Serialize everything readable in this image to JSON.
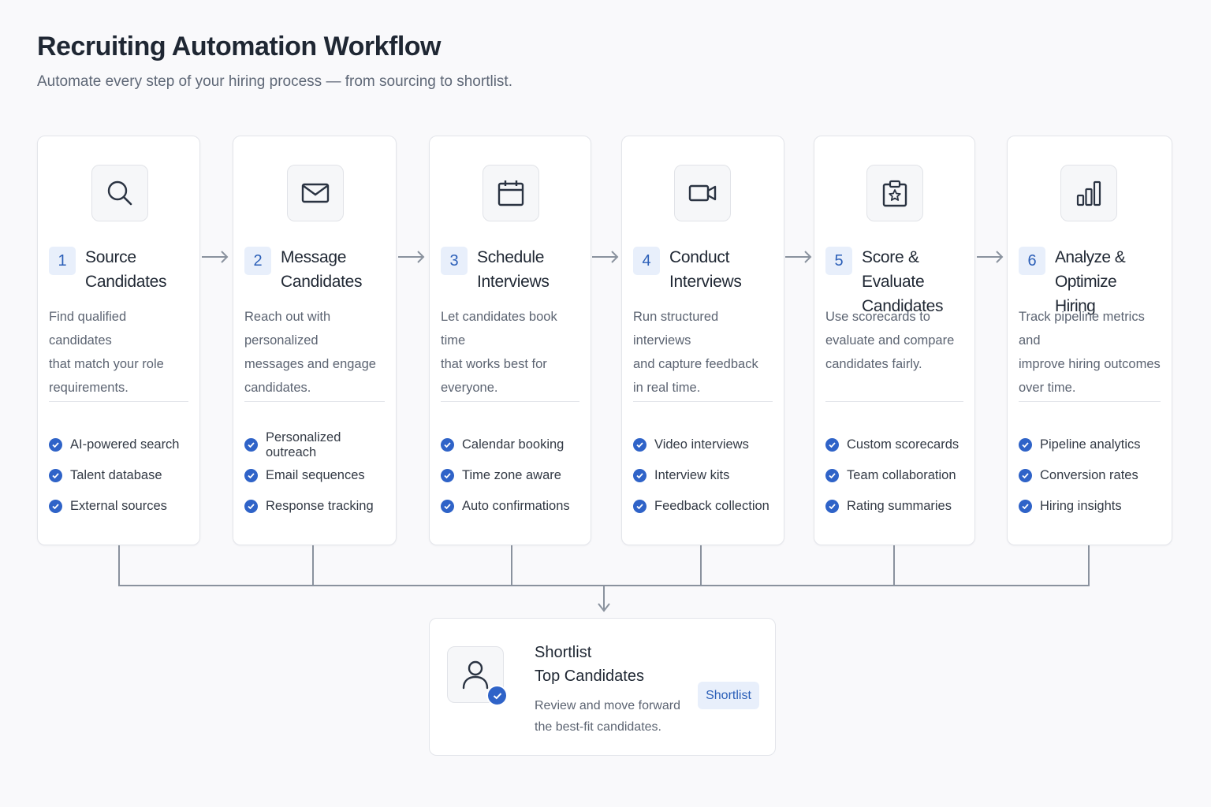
{
  "header": {
    "title": "Recruiting Automation Workflow",
    "subtitle": "Automate every step of your hiring process — from sourcing to shortlist."
  },
  "colors": {
    "accent": "#2f63c8",
    "badge_bg": "#e8effb",
    "card_border": "#e3e5ea",
    "connector": "#8a929e"
  },
  "steps": [
    {
      "number": "1",
      "icon": "search-icon",
      "title_line1": "Source",
      "title_line2": "Candidates",
      "desc_line1": "Find qualified candidates",
      "desc_line2": "that match your role",
      "desc_line3": "requirements.",
      "features": [
        "AI-powered search",
        "Talent database",
        "External sources"
      ]
    },
    {
      "number": "2",
      "icon": "mail-icon",
      "title_line1": "Message",
      "title_line2": "Candidates",
      "desc_line1": "Reach out with personalized",
      "desc_line2": "messages and engage",
      "desc_line3": "candidates.",
      "features": [
        "Personalized outreach",
        "Email sequences",
        "Response tracking"
      ]
    },
    {
      "number": "3",
      "icon": "calendar-icon",
      "title_line1": "Schedule",
      "title_line2": "Interviews",
      "desc_line1": "Let candidates book time",
      "desc_line2": "that works best for",
      "desc_line3": "everyone.",
      "features": [
        "Calendar booking",
        "Time zone aware",
        "Auto confirmations"
      ]
    },
    {
      "number": "4",
      "icon": "video-camera-icon",
      "title_line1": "Conduct",
      "title_line2": "Interviews",
      "desc_line1": "Run structured interviews",
      "desc_line2": "and capture feedback",
      "desc_line3": "in real time.",
      "features": [
        "Video interviews",
        "Interview kits",
        "Feedback collection"
      ]
    },
    {
      "number": "5",
      "icon": "scorecard-star-icon",
      "title_line1": "Score & Evaluate",
      "title_line2": "Candidates",
      "desc_line1": "Use scorecards to",
      "desc_line2": "evaluate and compare",
      "desc_line3": "candidates fairly.",
      "features": [
        "Custom scorecards",
        "Team collaboration",
        "Rating summaries"
      ]
    },
    {
      "number": "6",
      "icon": "bar-chart-icon",
      "title_line1": "Analyze & Optimize",
      "title_line2": "Hiring",
      "desc_line1": "Track pipeline metrics and",
      "desc_line2": "improve hiring outcomes",
      "desc_line3": "over time.",
      "features": [
        "Pipeline analytics",
        "Conversion rates",
        "Hiring insights"
      ]
    }
  ],
  "shortlist": {
    "icon": "user-check-icon",
    "title_line1": "Shortlist",
    "title_line2": "Top Candidates",
    "desc_line1": "Review and move forward",
    "desc_line2": "the best-fit candidates.",
    "button_label": "Shortlist"
  }
}
